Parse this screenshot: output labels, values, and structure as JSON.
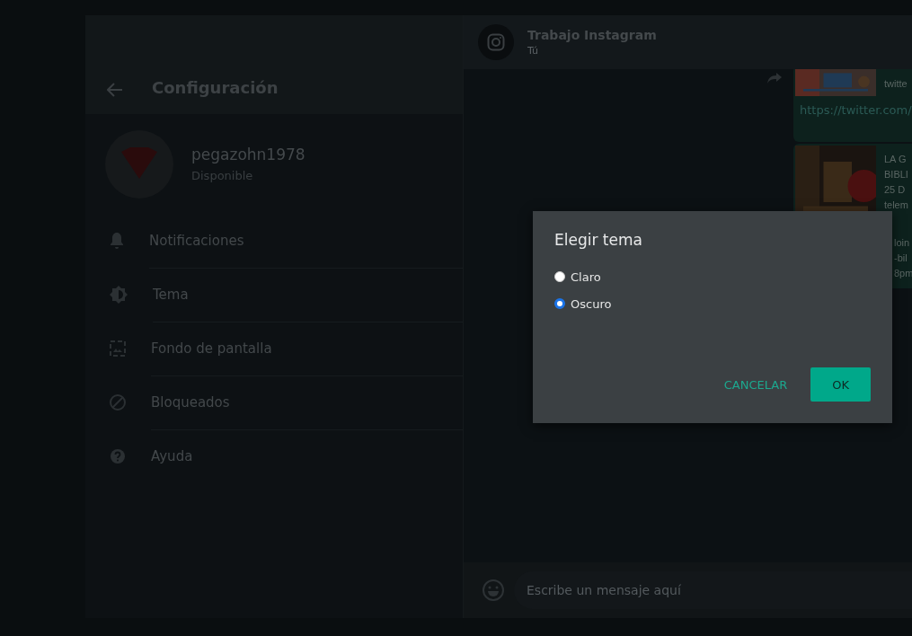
{
  "settings": {
    "title": "Configuración",
    "profile": {
      "name": "pegazohn1978",
      "status": "Disponible"
    },
    "items": [
      {
        "label": "Notificaciones",
        "kind": "bell"
      },
      {
        "label": "Tema",
        "kind": "theme"
      },
      {
        "label": "Fondo de pantalla",
        "kind": "wallpaper"
      },
      {
        "label": "Bloqueados",
        "kind": "blocked"
      },
      {
        "label": "Ayuda",
        "kind": "help"
      }
    ]
  },
  "chat": {
    "title": "Trabajo Instagram",
    "subtitle": "Tú",
    "messages": [
      {
        "kind": "link",
        "title": "twitte",
        "link": "https://twitter.com/"
      },
      {
        "kind": "article",
        "lines": [
          "LA G",
          "BIBLI",
          "25 D",
          "telem"
        ],
        "more": [
          "loin",
          "-bil",
          "8pm"
        ]
      }
    ],
    "composer": {
      "placeholder": "Escribe un mensaje aquí"
    }
  },
  "dialog": {
    "title": "Elegir tema",
    "options": [
      {
        "label": "Claro",
        "selected": false
      },
      {
        "label": "Oscuro",
        "selected": true
      }
    ],
    "buttons": [
      {
        "label": "CANCELAR",
        "kind": "text"
      },
      {
        "label": "OK",
        "kind": "filled"
      }
    ]
  }
}
